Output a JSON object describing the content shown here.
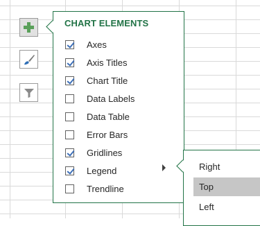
{
  "panel": {
    "title": "CHART ELEMENTS",
    "items": [
      {
        "label": "Axes",
        "checked": true
      },
      {
        "label": "Axis Titles",
        "checked": true
      },
      {
        "label": "Chart Title",
        "checked": true
      },
      {
        "label": "Data Labels",
        "checked": false
      },
      {
        "label": "Data Table",
        "checked": false
      },
      {
        "label": "Error Bars",
        "checked": false
      },
      {
        "label": "Gridlines",
        "checked": true
      },
      {
        "label": "Legend",
        "checked": true
      },
      {
        "label": "Trendline",
        "checked": false
      }
    ]
  },
  "legend_submenu": {
    "items": [
      {
        "label": "Right",
        "selected": false
      },
      {
        "label": "Top",
        "selected": true
      },
      {
        "label": "Left",
        "selected": false
      }
    ]
  },
  "side_buttons": [
    {
      "icon": "plus-icon"
    },
    {
      "icon": "brush-icon"
    },
    {
      "icon": "filter-icon"
    }
  ],
  "colors": {
    "accent": "#217346",
    "plus": "#5aa05a",
    "checkmark": "#3d6fb7",
    "selected_bg": "#c6c6c6",
    "gridline": "#d9d9d9"
  }
}
